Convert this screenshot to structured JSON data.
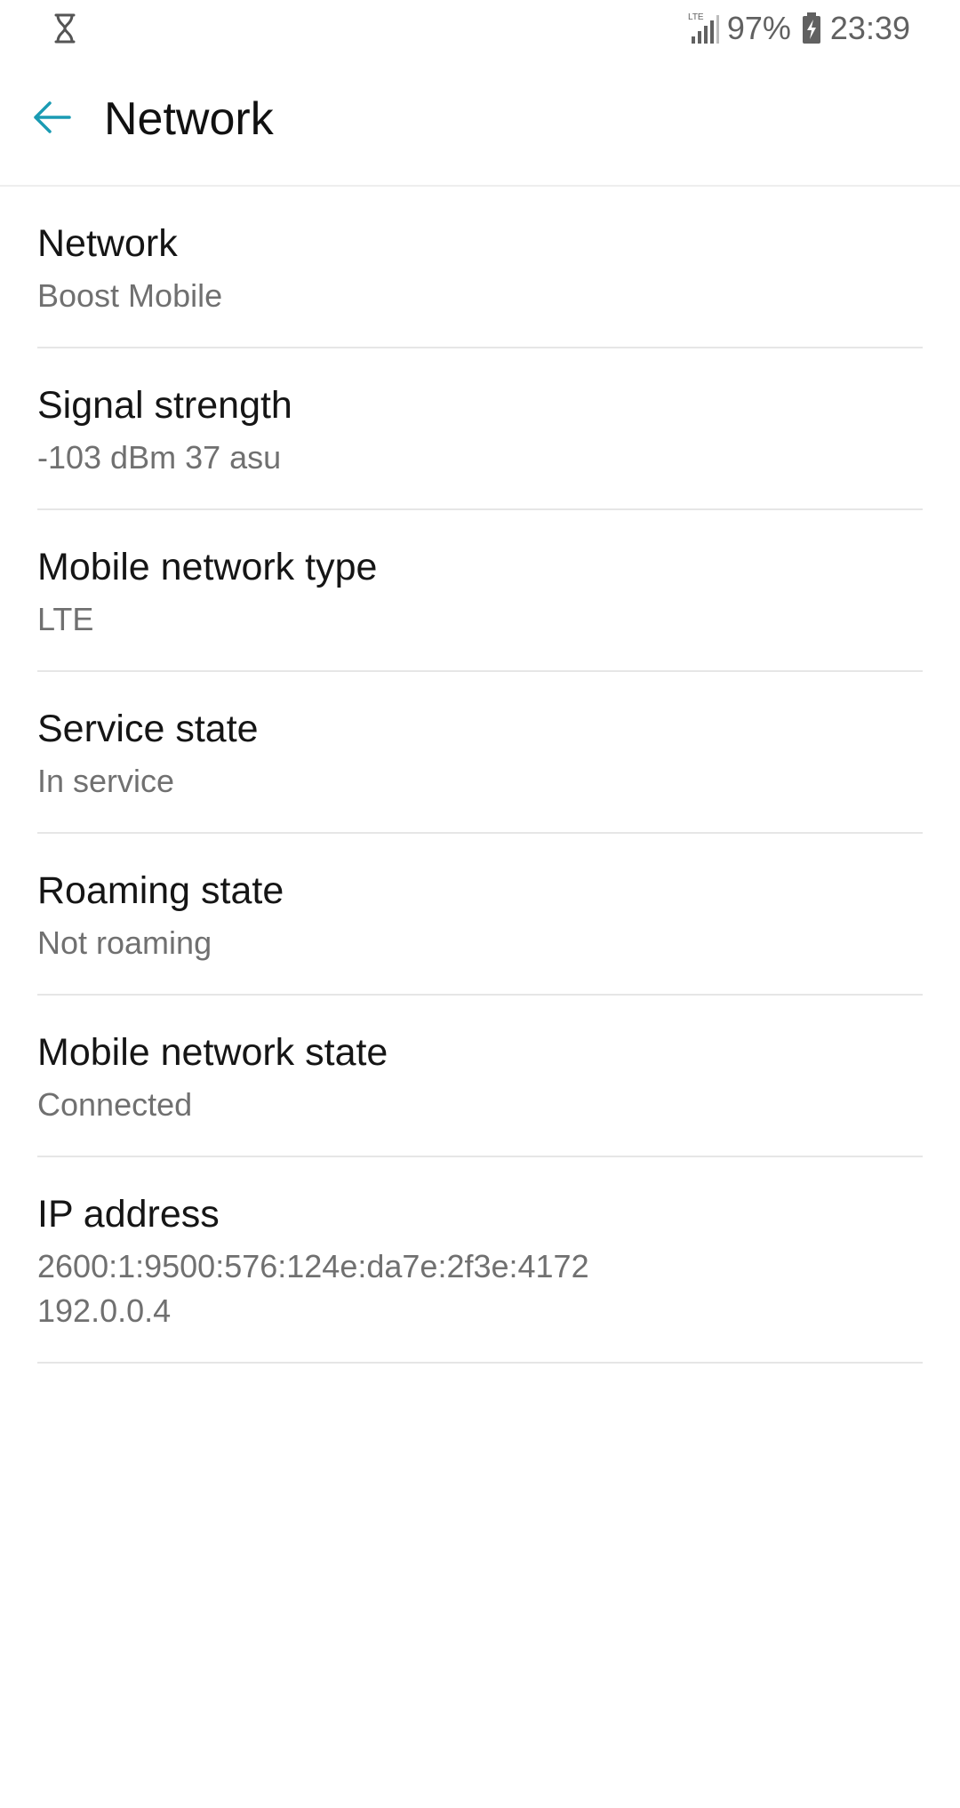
{
  "status_bar": {
    "left_icon": "hourglass-icon",
    "network_badge": "LTE",
    "signal_icon": "signal-icon",
    "battery_percent": "97%",
    "battery_icon": "battery-charging-icon",
    "time": "23:39"
  },
  "app_bar": {
    "back_icon": "arrow-back-icon",
    "title": "Network",
    "accent_color": "#1a9bb3"
  },
  "items": [
    {
      "title": "Network",
      "value": "Boost Mobile"
    },
    {
      "title": "Signal strength",
      "value": "-103 dBm 37 asu"
    },
    {
      "title": "Mobile network type",
      "value": "LTE"
    },
    {
      "title": "Service state",
      "value": "In service"
    },
    {
      "title": "Roaming state",
      "value": "Not roaming"
    },
    {
      "title": "Mobile network state",
      "value": "Connected"
    },
    {
      "title": "IP address",
      "values": [
        "2600:1:9500:576:124e:da7e:2f3e:4172",
        "192.0.0.4"
      ]
    }
  ]
}
